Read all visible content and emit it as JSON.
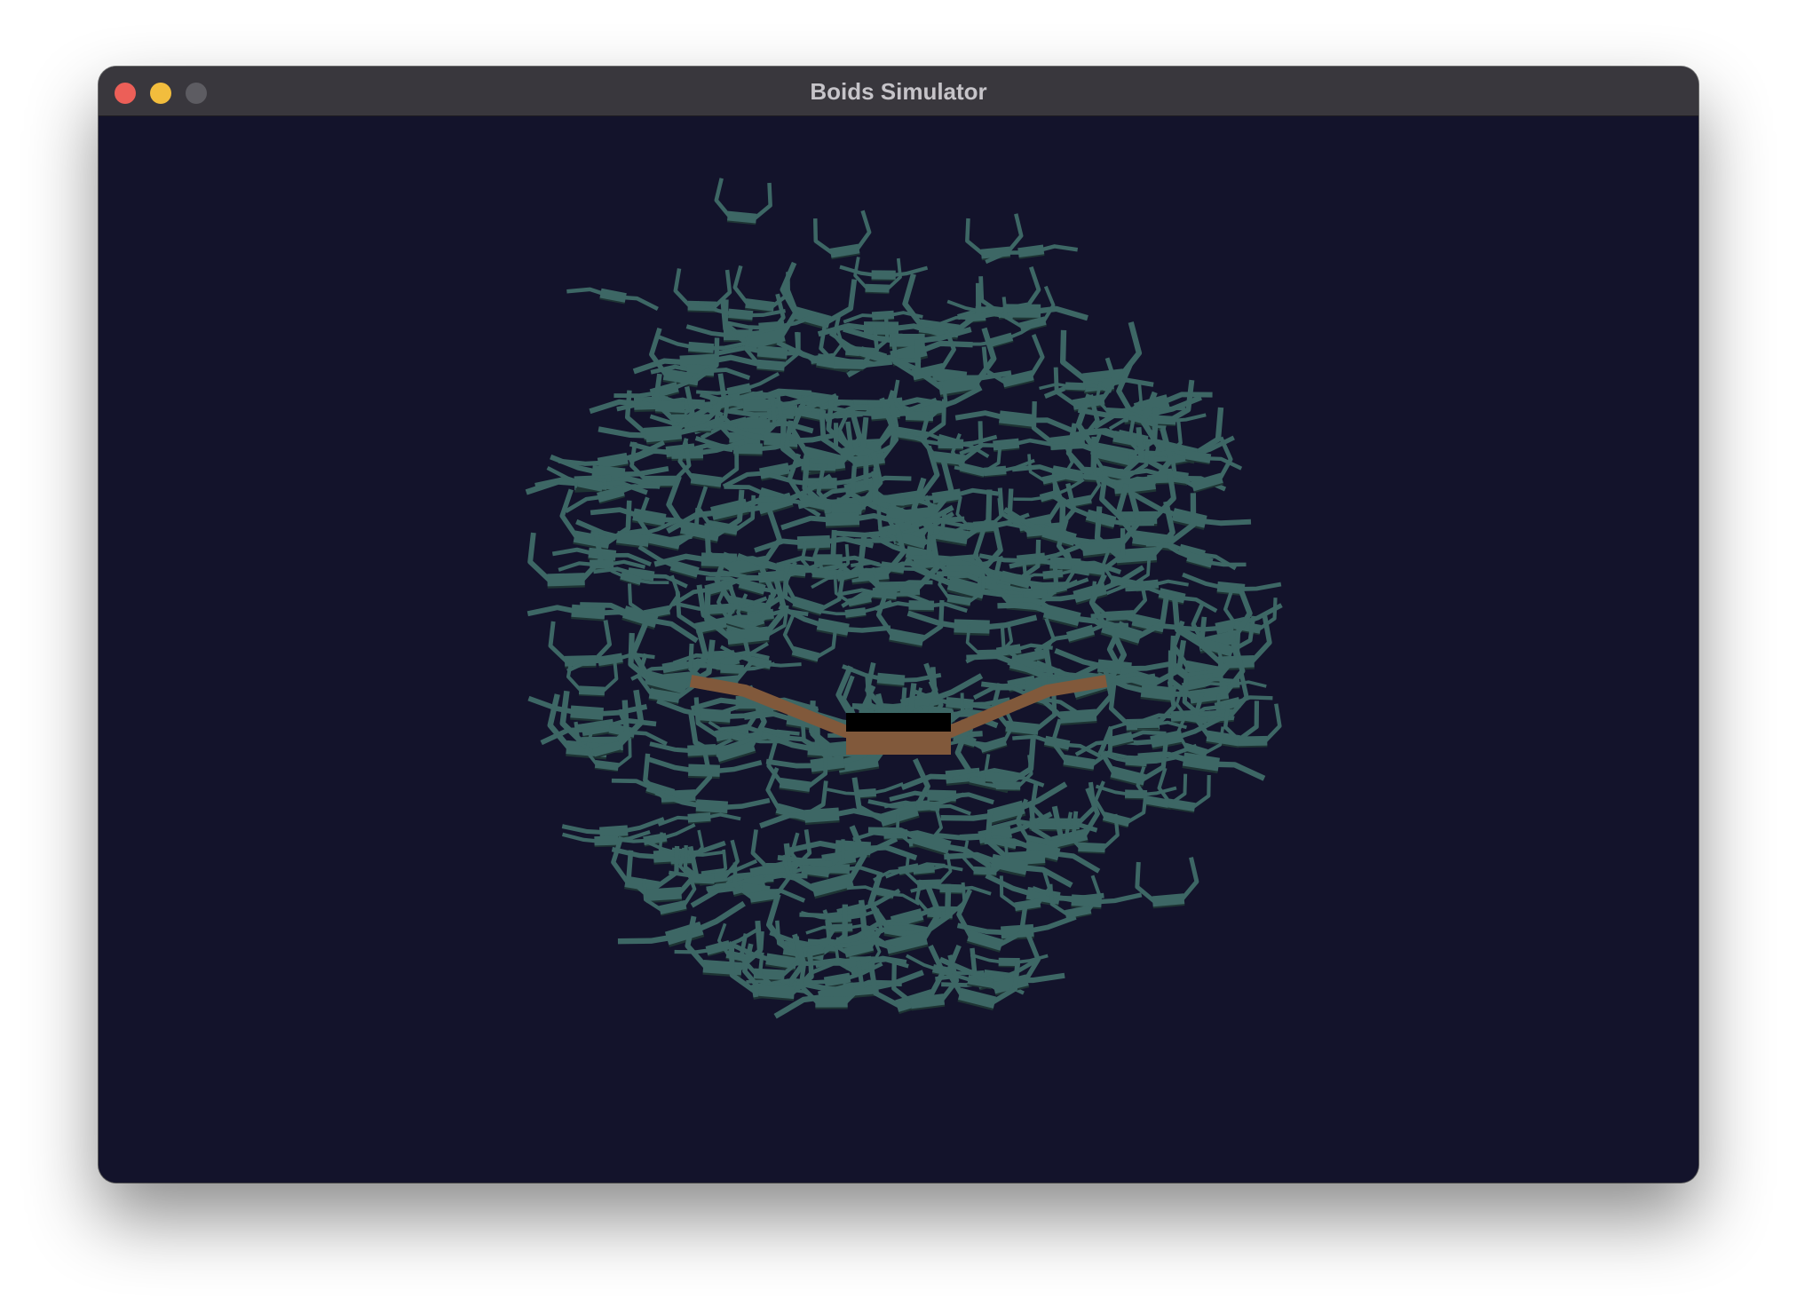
{
  "window": {
    "title": "Boids Simulator",
    "controls": {
      "close_color": "#ec5f58",
      "minimize_color": "#f2bd3d",
      "zoom_color": "#5d5c62"
    }
  },
  "scene": {
    "background_color": "#13132b",
    "boid_color": "#3d6765",
    "boid_shadow_color": "#1e3434",
    "bird_color": "#81593b",
    "bird_body_shadow": "#000000"
  }
}
